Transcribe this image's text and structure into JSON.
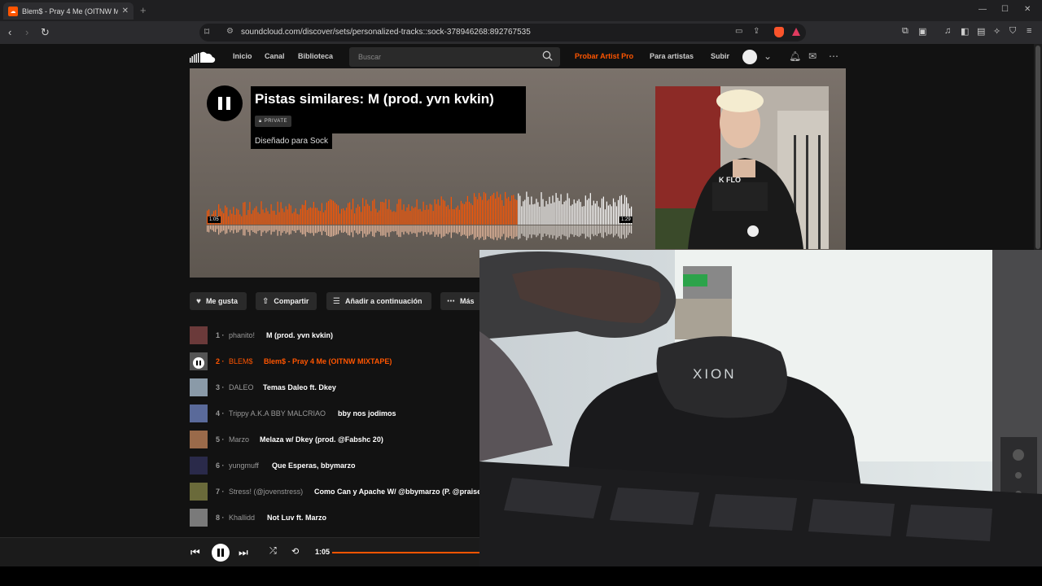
{
  "browser": {
    "tab_title": "Blem$ - Pray 4 Me (OITNW M",
    "url": "soundcloud.com/discover/sets/personalized-tracks::sock-378946268:892767535",
    "new_tab": "+",
    "minimize": "—",
    "maximize": "☐",
    "close": "✕"
  },
  "header": {
    "nav": [
      "Inicio",
      "Canal",
      "Biblioteca"
    ],
    "search_placeholder": "Buscar",
    "pro_link": "Probar Artist Pro",
    "for_artists": "Para artistas",
    "upload": "Subir"
  },
  "hero": {
    "title": "Pistas similares: M (prod. yvn kvkin)",
    "private_label": "PRIVATE",
    "subtitle": "Diseñado para Sock",
    "elapsed": "1:05",
    "duration": "1:29",
    "played_fraction": 0.73
  },
  "actions": {
    "like": "Me gusta",
    "share": "Compartir",
    "add_next": "Añadir a continuación",
    "more": "Más"
  },
  "tracks": [
    {
      "num": "1 ·",
      "artist": "phanito!",
      "title": "M (prod. yvn kvkin)",
      "thumb": "#6b3a3a"
    },
    {
      "num": "2 ·",
      "artist": "BLEM$",
      "title": "Blem$ - Pray 4 Me (OITNW MIXTAPE)",
      "thumb": "#555555",
      "active": true
    },
    {
      "num": "3 ·",
      "artist": "DALEO",
      "title": "Temas Daleo ft. Dkey",
      "thumb": "#8a9aa8"
    },
    {
      "num": "4 ·",
      "artist": "Trippy A.K.A BBY MALCRIAO",
      "title": "bby nos jodimos",
      "thumb": "#5a6a9a"
    },
    {
      "num": "5 ·",
      "artist": "Marzo",
      "title": "Melaza w/ Dkey (prod. @Fabshc 20)",
      "thumb": "#9a6a4a"
    },
    {
      "num": "6 ·",
      "artist": "yungmuff",
      "title": "Que Esperas, bbymarzo",
      "thumb": "#2a2a4a"
    },
    {
      "num": "7 ·",
      "artist": "Stress! (@jovenstress)",
      "title": "Como Can y Apache W/ @bbymarzo (P. @praiset",
      "thumb": "#6a6a3a"
    },
    {
      "num": "8 ·",
      "artist": "Khallidd",
      "title": "Not Luv ft. Marzo",
      "thumb": "#7a7a7a"
    }
  ],
  "player": {
    "elapsed": "1:05"
  },
  "webcam": {
    "chair_brand": "XION"
  },
  "colors": {
    "accent": "#ff5500",
    "page_bg": "#121212"
  }
}
